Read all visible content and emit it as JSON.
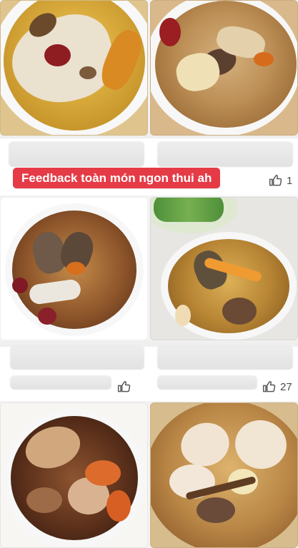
{
  "badge": {
    "text": "Feedback toàn món ngon thui ah",
    "color": "#e53b46"
  },
  "likes": [
    {
      "count": "1"
    },
    {
      "count": ""
    },
    {
      "count": "27"
    }
  ],
  "colors": {
    "background": "#f3f3f3",
    "panel": "#ffffff",
    "text_secondary": "#4d4d4d"
  },
  "icons": {
    "like": "thumbs-up-icon"
  }
}
